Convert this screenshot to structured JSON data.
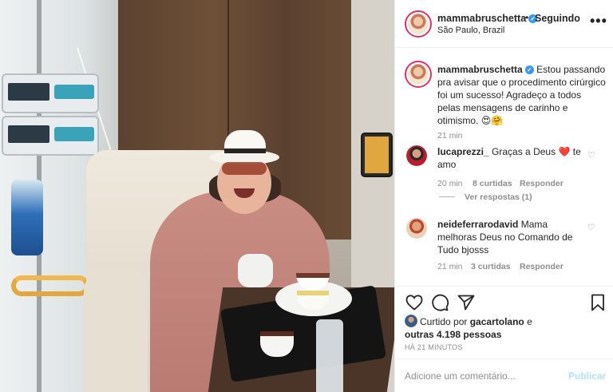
{
  "post": {
    "username": "mammabruschetta",
    "follow_status": "Seguindo",
    "separator": "•",
    "location": "São Paulo, Brazil",
    "more_label": "•••"
  },
  "caption": {
    "username": "mammabruschetta",
    "text": "Estou passando pra avisar que o procedimento cirúrgico foi um sucesso! Agradeço a todos pelas mensagens de carinho e otimismo.",
    "emoji": "😍🤗",
    "time": "21 min"
  },
  "comments": [
    {
      "username": "lucaprezzi_",
      "text": "Graças a Deus",
      "emoji": "❤️",
      "text_after": "te amo",
      "time": "20 min",
      "likes": "8 curtidas",
      "reply_label": "Responder",
      "view_replies": "Ver respostas (1)"
    },
    {
      "username": "neideferrarodavid",
      "text": "Mama melhoras Deus no Comando de Tudo bjosss",
      "time": "21 min",
      "likes": "3 curtidas",
      "reply_label": "Responder"
    }
  ],
  "likes_summary": {
    "prefix": "Curtido por",
    "first_user": "gacartolano",
    "connector": "e",
    "others": "outras 4.198 pessoas"
  },
  "posted_ago": "HÁ 21 MINUTOS",
  "comment_box": {
    "placeholder": "Adicione um comentário...",
    "post_label": "Publicar"
  },
  "colors": {
    "verified": "#3897f0",
    "story_ring": "#e1306c",
    "secondary_text": "#8e8e8e",
    "post_disabled": "#b2dffc"
  }
}
